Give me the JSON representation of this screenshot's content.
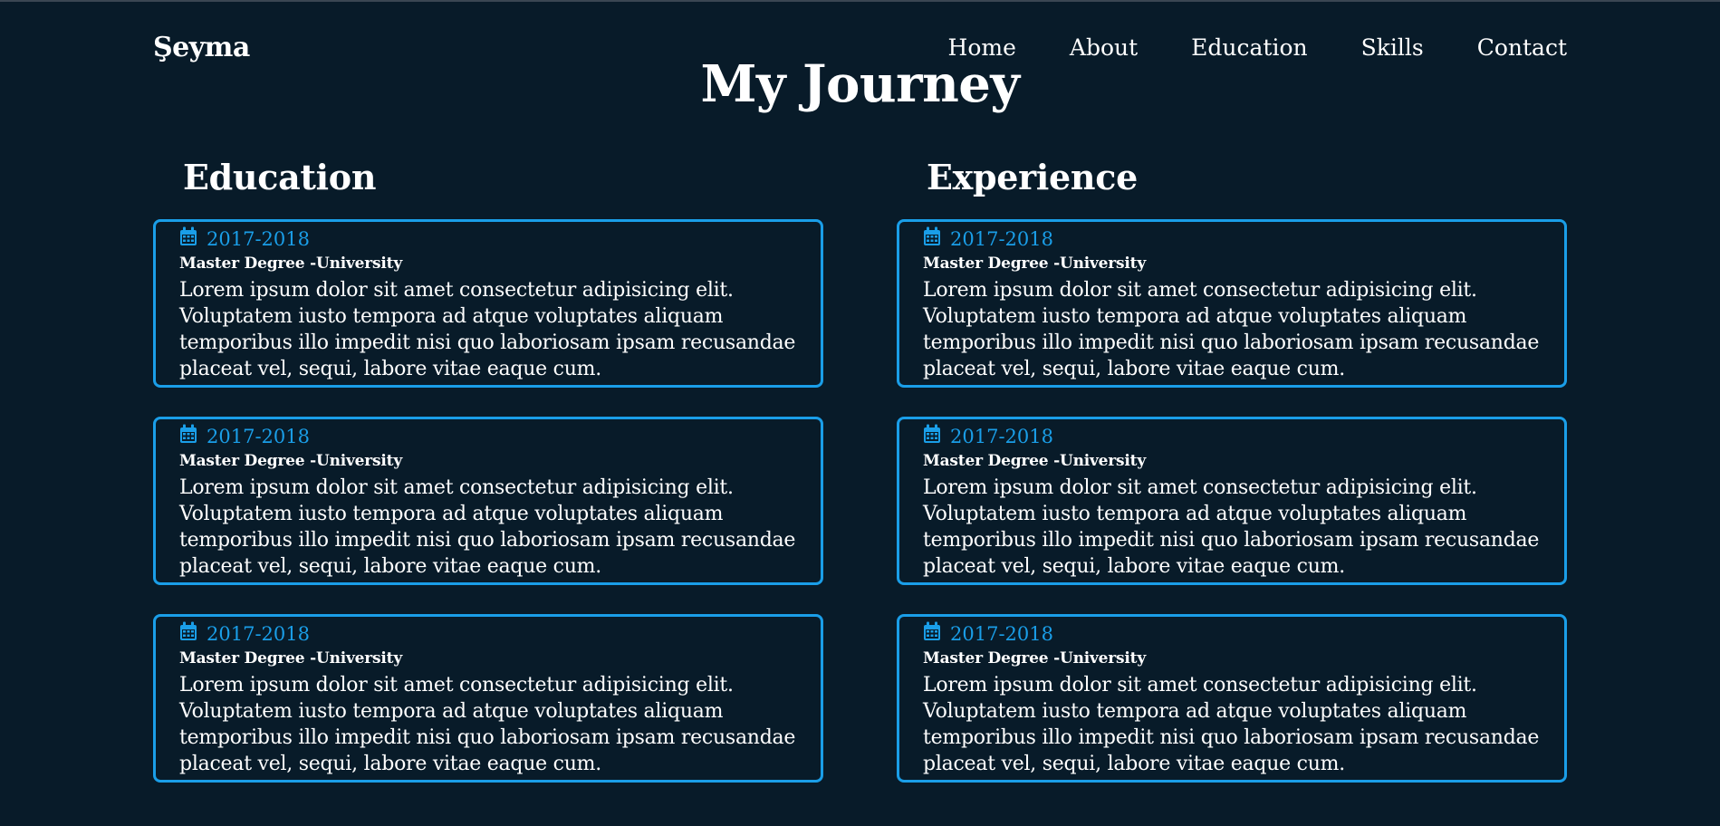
{
  "header": {
    "logo": "Şeyma",
    "nav": [
      "Home",
      "About",
      "Education",
      "Skills",
      "Contact"
    ]
  },
  "page_title": "My Journey",
  "education": {
    "heading": "Education",
    "items": [
      {
        "date": "2017-2018",
        "title": "Master Degree -University",
        "description": "Lorem ipsum dolor sit amet consectetur adipisicing elit. Voluptatem iusto tempora ad atque voluptates aliquam temporibus illo impedit nisi quo laboriosam ipsam recusandae placeat vel, sequi, labore vitae eaque cum."
      },
      {
        "date": "2017-2018",
        "title": "Master Degree -University",
        "description": "Lorem ipsum dolor sit amet consectetur adipisicing elit. Voluptatem iusto tempora ad atque voluptates aliquam temporibus illo impedit nisi quo laboriosam ipsam recusandae placeat vel, sequi, labore vitae eaque cum."
      },
      {
        "date": "2017-2018",
        "title": "Master Degree -University",
        "description": "Lorem ipsum dolor sit amet consectetur adipisicing elit. Voluptatem iusto tempora ad atque voluptates aliquam temporibus illo impedit nisi quo laboriosam ipsam recusandae placeat vel, sequi, labore vitae eaque cum."
      }
    ]
  },
  "experience": {
    "heading": "Experience",
    "items": [
      {
        "date": "2017-2018",
        "title": "Master Degree -University",
        "description": "Lorem ipsum dolor sit amet consectetur adipisicing elit. Voluptatem iusto tempora ad atque voluptates aliquam temporibus illo impedit nisi quo laboriosam ipsam recusandae placeat vel, sequi, labore vitae eaque cum."
      },
      {
        "date": "2017-2018",
        "title": "Master Degree -University",
        "description": "Lorem ipsum dolor sit amet consectetur adipisicing elit. Voluptatem iusto tempora ad atque voluptates aliquam temporibus illo impedit nisi quo laboriosam ipsam recusandae placeat vel, sequi, labore vitae eaque cum."
      },
      {
        "date": "2017-2018",
        "title": "Master Degree -University",
        "description": "Lorem ipsum dolor sit amet consectetur adipisicing elit. Voluptatem iusto tempora ad atque voluptates aliquam temporibus illo impedit nisi quo laboriosam ipsam recusandae placeat vel, sequi, labore vitae eaque cum."
      }
    ]
  },
  "icons": {
    "date": "calendar-icon"
  },
  "colors": {
    "background": "#081b29",
    "accent": "#1a9ee8",
    "text": "#ffffff"
  }
}
